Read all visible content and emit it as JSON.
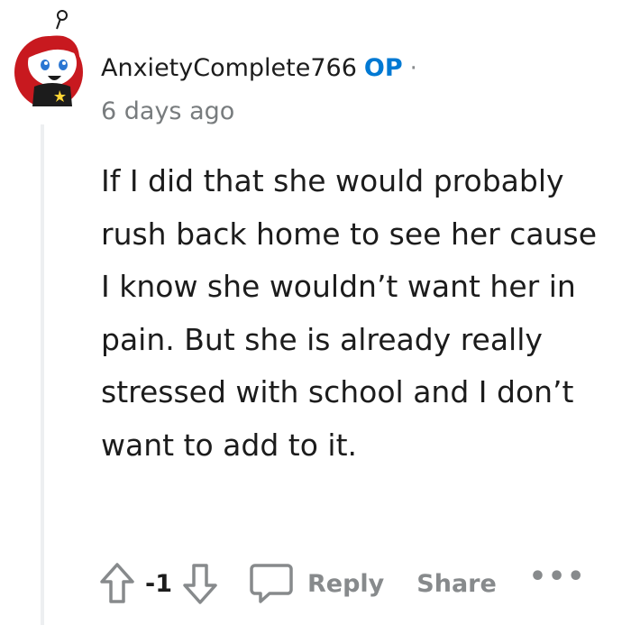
{
  "comment": {
    "username": "AnxietyComplete766",
    "op_badge": "OP",
    "separator": "·",
    "timestamp": "6 days ago",
    "body": "If I did that she would probably rush back home to see her cause I know she wouldn’t want her in pain. But she is already really stressed with school and I don’t want to add to it.",
    "score": "-1",
    "reply_label": "Reply",
    "share_label": "Share",
    "more_label": "•••"
  },
  "icons": {
    "avatar": "avatar",
    "upvote": "upvote-arrow-icon",
    "downvote": "downvote-arrow-icon",
    "reply": "speech-bubble-icon"
  },
  "colors": {
    "op": "#0079d3",
    "muted": "#878a8c",
    "text": "#1c1c1c"
  }
}
